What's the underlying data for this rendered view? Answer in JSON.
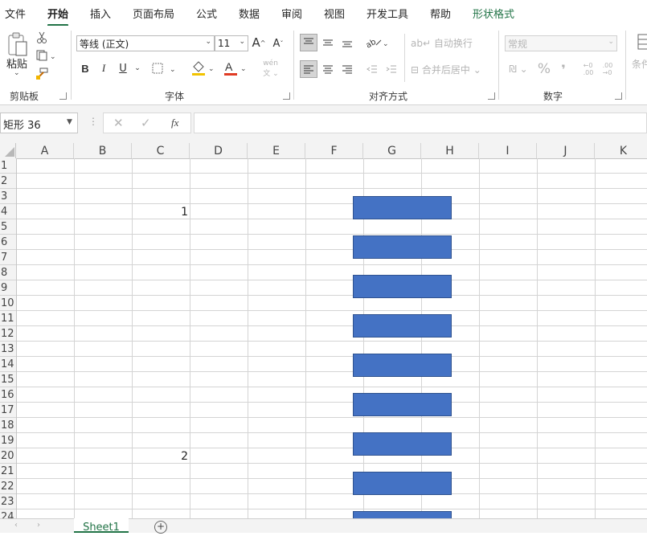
{
  "ribbon_tabs": [
    {
      "label": "文件"
    },
    {
      "label": "开始"
    },
    {
      "label": "插入"
    },
    {
      "label": "页面布局"
    },
    {
      "label": "公式"
    },
    {
      "label": "数据"
    },
    {
      "label": "审阅"
    },
    {
      "label": "视图"
    },
    {
      "label": "开发工具"
    },
    {
      "label": "帮助"
    },
    {
      "label": "形状格式"
    }
  ],
  "clipboard": {
    "paste_label": "粘贴",
    "group_label": "剪贴板"
  },
  "font": {
    "name": "等线 (正文)",
    "size": "11",
    "bold": "B",
    "italic": "I",
    "underline": "U",
    "group_label": "字体"
  },
  "alignment": {
    "wrap_text": "自动换行",
    "merge_center": "合并后居中",
    "group_label": "对齐方式"
  },
  "number": {
    "format": "常规",
    "percent": "%",
    "comma": "❜",
    "group_label": "数字"
  },
  "styles": {
    "conditional_partial": "条件"
  },
  "formula_bar": {
    "name_box": "矩形 36",
    "fx": "fx",
    "formula": ""
  },
  "columns": [
    "A",
    "B",
    "C",
    "D",
    "E",
    "F",
    "G",
    "H",
    "I",
    "J",
    "K"
  ],
  "rows": [
    "1",
    "2",
    "3",
    "4",
    "5",
    "6",
    "7",
    "8",
    "9",
    "10",
    "11",
    "12",
    "13",
    "14",
    "15",
    "16",
    "17",
    "18",
    "19",
    "20",
    "21",
    "22",
    "23",
    "24"
  ],
  "cell_values": [
    {
      "ref": "C4",
      "value": "1"
    },
    {
      "ref": "C20",
      "value": "2"
    }
  ],
  "shapes_count_visible": 9,
  "sheet_tabs": [
    {
      "label": "Sheet1"
    }
  ],
  "colors": {
    "accent": "#217346",
    "shape_fill": "#4472c4",
    "shape_border": "#2f528f"
  }
}
